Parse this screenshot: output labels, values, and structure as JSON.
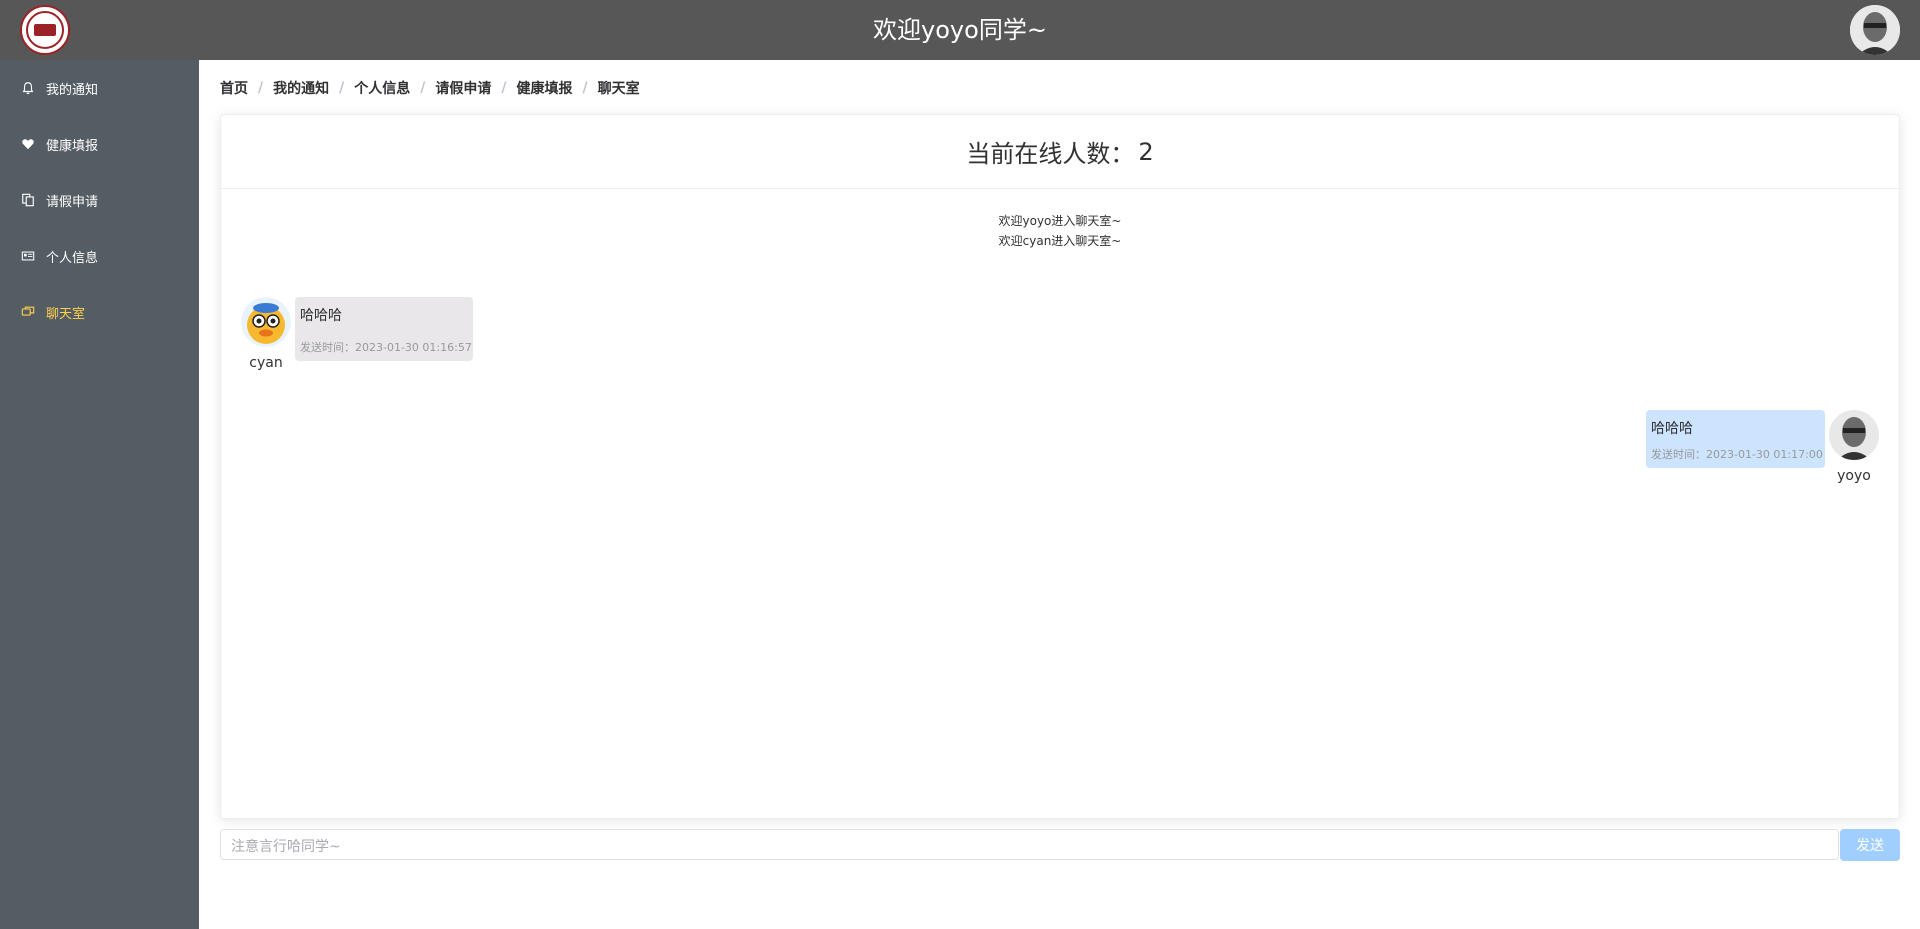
{
  "header": {
    "title": "欢迎yoyo同学~"
  },
  "sidebar": {
    "items": [
      {
        "label": "我的通知",
        "icon": "bell-icon"
      },
      {
        "label": "健康填报",
        "icon": "heart-icon"
      },
      {
        "label": "请假申请",
        "icon": "documents-icon"
      },
      {
        "label": "个人信息",
        "icon": "id-card-icon"
      },
      {
        "label": "聊天室",
        "icon": "chat-icon",
        "active": true
      }
    ],
    "background": "#545c64",
    "active_color": "#ffd04b"
  },
  "breadcrumb": [
    "首页",
    "我的通知",
    "个人信息",
    "请假申请",
    "健康填报",
    "聊天室"
  ],
  "chat": {
    "online_label": "当前在线人数：",
    "online_count": "2",
    "system_messages": [
      "欢迎yoyo进入聊天室~",
      "欢迎cyan进入聊天室~"
    ],
    "messages": [
      {
        "user": "cyan",
        "text": "哈哈哈",
        "time": "发送时间：2023-01-30 01:16:57",
        "side": "left"
      },
      {
        "user": "yoyo",
        "text": "哈哈哈",
        "time": "发送时间：2023-01-30 01:17:00",
        "side": "right"
      }
    ]
  },
  "composer": {
    "placeholder": "注意言行哈同学~",
    "send_label": "发送"
  }
}
